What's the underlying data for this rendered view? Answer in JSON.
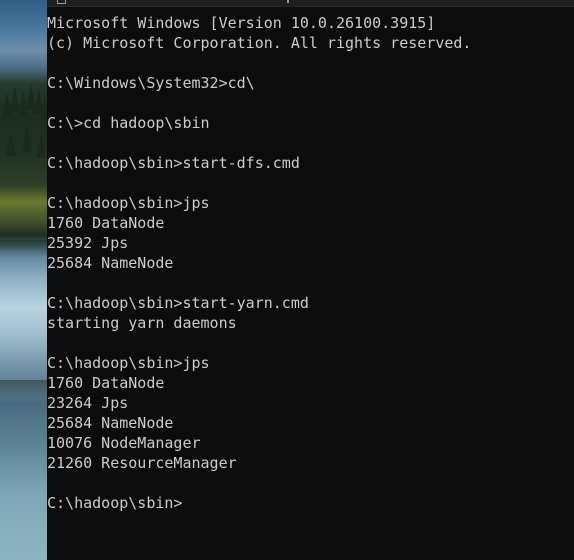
{
  "terminal": {
    "lines": [
      "Microsoft Windows [Version 10.0.26100.3915]",
      "(c) Microsoft Corporation. All rights reserved.",
      "",
      "C:\\Windows\\System32>cd\\",
      "",
      "C:\\>cd hadoop\\sbin",
      "",
      "C:\\hadoop\\sbin>start-dfs.cmd",
      "",
      "C:\\hadoop\\sbin>jps",
      "1760 DataNode",
      "25392 Jps",
      "25684 NameNode",
      "",
      "C:\\hadoop\\sbin>start-yarn.cmd",
      "starting yarn daemons",
      "",
      "C:\\hadoop\\sbin>jps",
      "1760 DataNode",
      "23264 Jps",
      "25684 NameNode",
      "10076 NodeManager",
      "21260 ResourceManager",
      "",
      "C:\\hadoop\\sbin>"
    ]
  },
  "colors": {
    "background": "#0c0c0c",
    "foreground": "#cccccc"
  }
}
